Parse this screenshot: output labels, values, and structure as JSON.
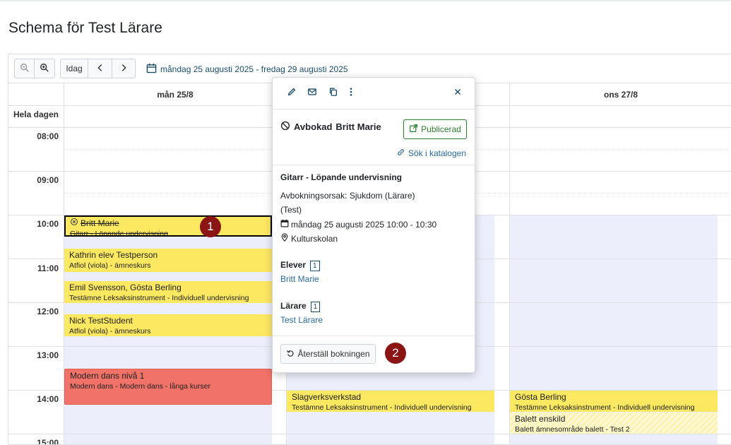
{
  "page_title": "Schema för Test Lärare",
  "toolbar": {
    "zoom_out_icon": "zoom-out-icon",
    "zoom_in_icon": "zoom-in-icon",
    "today_label": "Idag",
    "prev_icon": "chevron-left-icon",
    "next_icon": "chevron-right-icon",
    "date_range": "måndag 25 augusti 2025 - fredag 29 augusti 2025"
  },
  "calendar": {
    "columns": [
      "mån 25/8",
      "ons 27/8"
    ],
    "all_day_label": "Hela dagen",
    "hours": [
      "08:00",
      "09:00",
      "10:00",
      "11:00",
      "12:00",
      "13:00",
      "14:00",
      "15:00"
    ],
    "events": [
      {
        "title": "Britt Marie",
        "subtitle": "Gitarr - Löpande undervisning",
        "status": "cancelled"
      },
      {
        "title": "Kathrin elev Testperson",
        "subtitle": "Atfiol (viola) - ämneskurs"
      },
      {
        "title": "Emil Svensson, Gösta Berling",
        "subtitle": "Testämne Leksaksinstrument - Individuell undervisning"
      },
      {
        "title": "Nick TestStudent",
        "subtitle": "Atfiol (viola) - ämneskurs"
      },
      {
        "title": "Modern dans nivå 1",
        "subtitle": "Modern dans - Modern dans - långa kurser"
      },
      {
        "title": "Slagverksverkstad",
        "subtitle": "Testämne Leksaksinstrument - Individuell undervisning"
      },
      {
        "title": "Gösta Berling",
        "subtitle": "Testämne Leksaksinstrument - Individuell undervisning"
      },
      {
        "title": "Balett enskild",
        "subtitle": "Balett ämnesområde balett - Test 2"
      }
    ]
  },
  "markers": [
    "1",
    "2"
  ],
  "popup": {
    "icons": [
      "pencil-icon",
      "envelope-icon",
      "copy-icon",
      "more-vertical-icon",
      "close-icon"
    ],
    "status_label": "Avbokad",
    "student_name": "Britt Marie",
    "published_label": "Publicerad",
    "catalog_link": "Sök i katalogen",
    "course": "Gitarr - Löpande undervisning",
    "cancel_reason_line1": "Avbokningsorsak: Sjukdom (Lärare)",
    "cancel_reason_line2": "(Test)",
    "datetime": "måndag 25 augusti 2025 10:00 - 10:30",
    "location": "Kulturskolan",
    "students_heading": "Elever",
    "students_count": "1",
    "student_link": "Britt Marie",
    "teachers_heading": "Lärare",
    "teachers_count": "1",
    "teacher_link": "Test Lärare",
    "restore_button": "Återställ bokningen"
  },
  "colors": {
    "event_yellow": "#fde862",
    "event_red": "#f07268",
    "link_blue": "#2b6a9a",
    "published_green": "#2e7d32",
    "marker_red": "#8b1515"
  }
}
